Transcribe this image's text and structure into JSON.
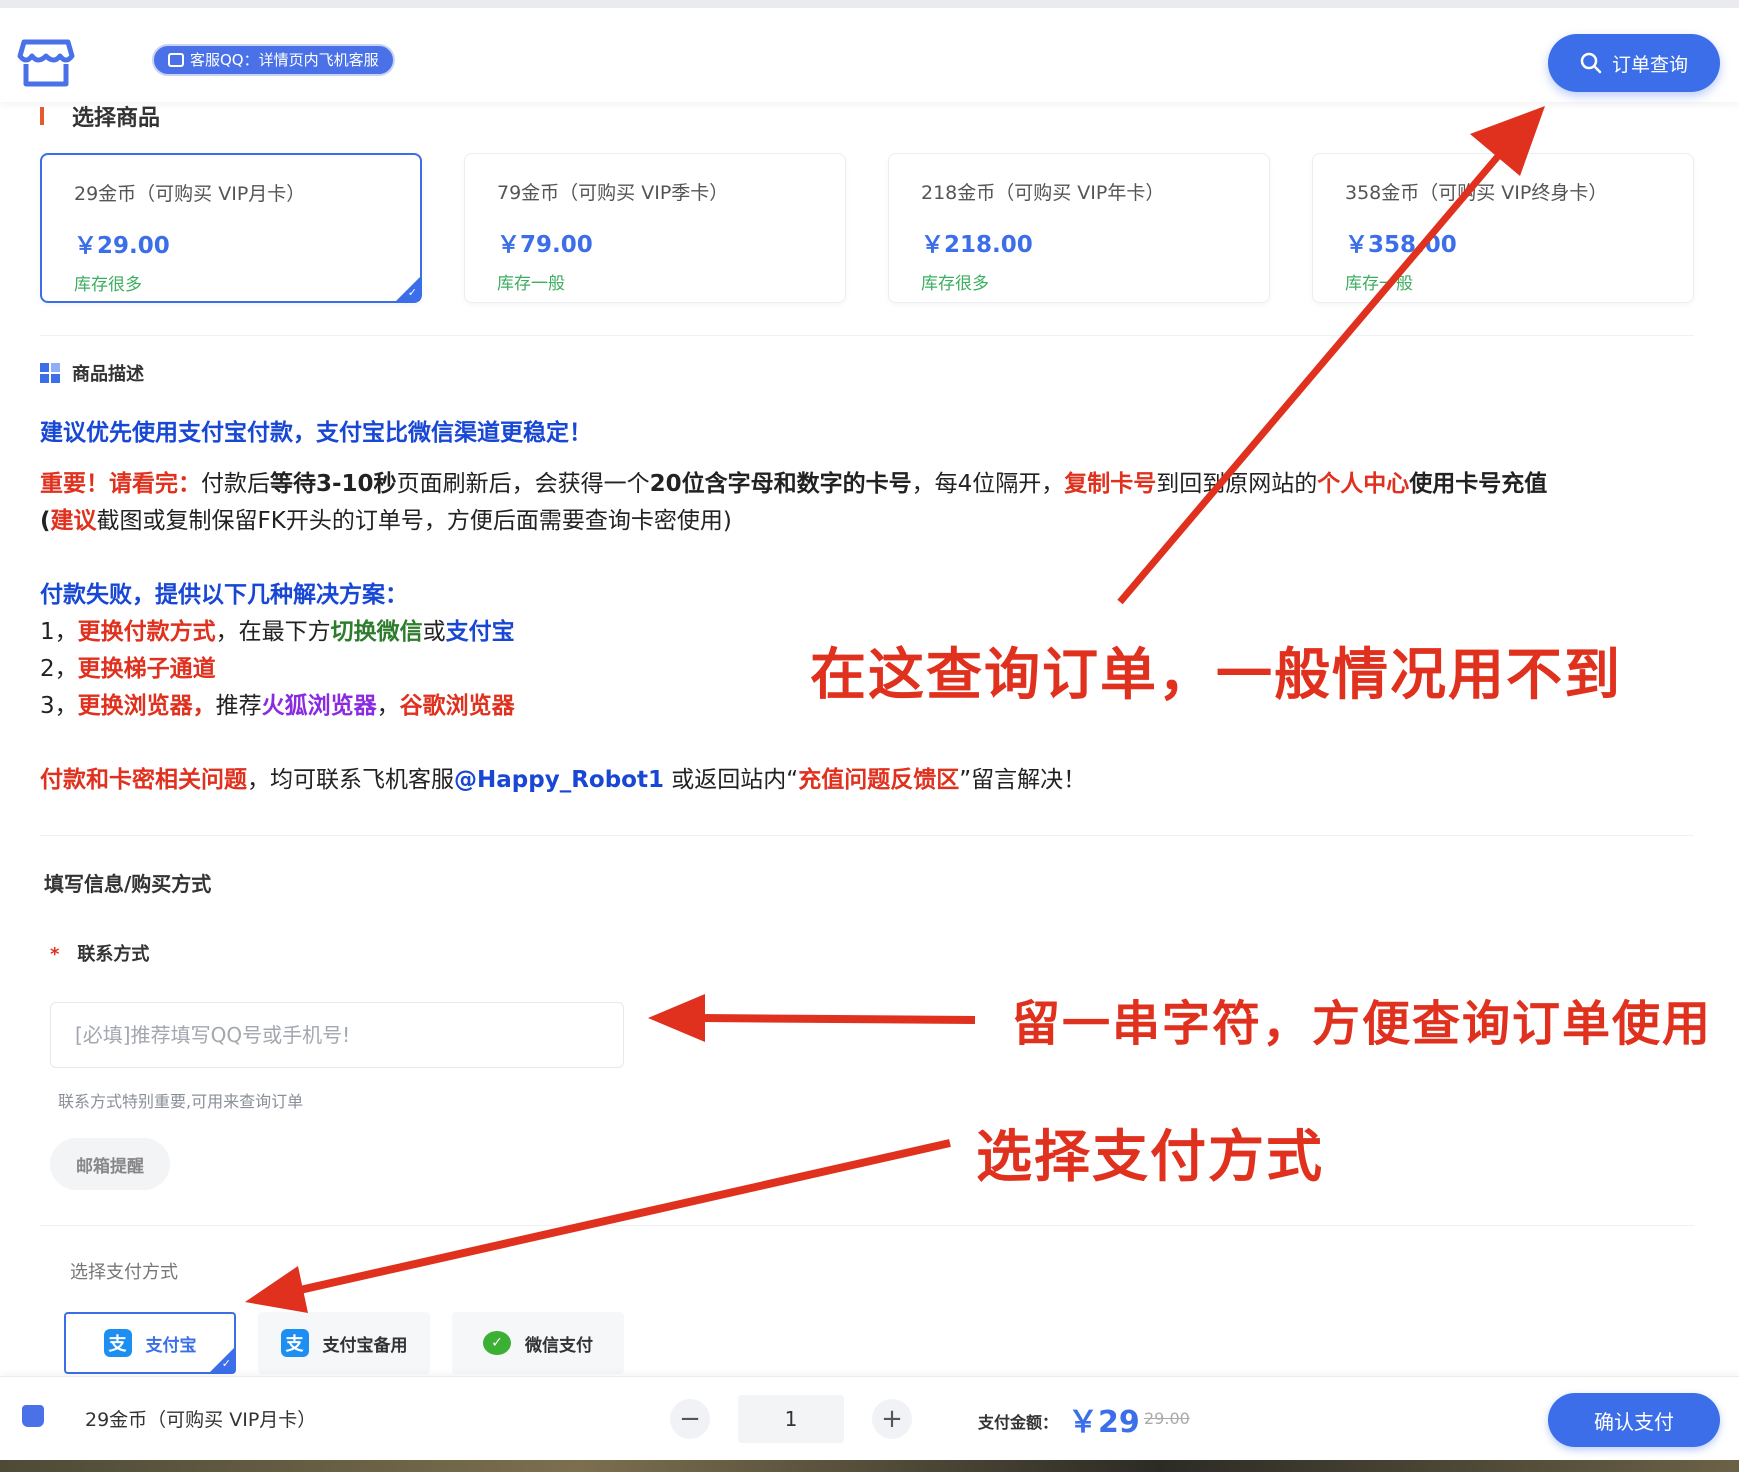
{
  "header": {
    "qq_badge": "客服QQ：详情页内飞机客服",
    "order_query_label": "订单查询"
  },
  "products_section": {
    "title": "选择商品",
    "items": [
      {
        "name": "29金币（可购买 VIP月卡）",
        "price": "￥29.00",
        "stock": "库存很多",
        "selected": true
      },
      {
        "name": "79金币（可购买 VIP季卡）",
        "price": "￥79.00",
        "stock": "库存一般",
        "selected": false
      },
      {
        "name": "218金币（可购买 VIP年卡）",
        "price": "￥218.00",
        "stock": "库存很多",
        "selected": false
      },
      {
        "name": "358金币（可购买 VIP终身卡）",
        "price": "￥358.00",
        "stock": "库存一般",
        "selected": false
      }
    ]
  },
  "description": {
    "title": "商品描述",
    "line1": "建议优先使用支付宝付款，支付宝比微信渠道更稳定！",
    "line2": {
      "a": "重要！请看完：",
      "b": "付款后",
      "c": "等待3-10秒",
      "d": "页面刷新后，会获得一个",
      "e": "20位含字母和数字的卡号",
      "f": "，每4位隔开，",
      "g": "复制卡号",
      "h": "到回到原网站的",
      "i": "个人中心",
      "j": "使用卡号充值"
    },
    "line3": {
      "a": "(",
      "b": "建议",
      "c": "截图或复制保留FK开头的订单号，方便后面需要查询卡密使用)"
    },
    "fail_title": "付款失败，提供以下几种解决方案：",
    "fail1": {
      "num": "1，",
      "a": "更换付款方式",
      "b": "，在最下方",
      "c": "切换微信",
      "d": "或",
      "e": "支付宝"
    },
    "fail2": {
      "num": "2，",
      "a": "更换梯子通道"
    },
    "fail3": {
      "num": "3，",
      "a": "更换浏览器，",
      "b": "推荐",
      "c": "火狐浏览器",
      "d": "，",
      "e": "谷歌浏览器"
    },
    "contact": {
      "a": "付款和卡密相关问题",
      "b": "，均可联系飞机客服",
      "c": "@Happy_Robot1",
      "d": " 或返回站内“",
      "e": "充值问题反馈区",
      "f": "”留言解决！"
    }
  },
  "form": {
    "title": "填写信息/购买方式",
    "contact_label": "联系方式",
    "required_mark": "*",
    "contact_placeholder": "[必填]推荐填写QQ号或手机号!",
    "contact_value": "",
    "contact_hint": "联系方式特别重要,可用来查询订单",
    "mail_reminder": "邮箱提醒",
    "pay_title": "选择支付方式",
    "pay_methods": [
      {
        "label": "支付宝",
        "icon": "alipay-icon",
        "selected": true
      },
      {
        "label": "支付宝备用",
        "icon": "alipay-icon",
        "selected": false
      },
      {
        "label": "微信支付",
        "icon": "wechat-icon",
        "selected": false
      }
    ]
  },
  "bottom": {
    "product_name": "29金币（可购买 VIP月卡）",
    "quantity": "1",
    "minus": "−",
    "plus": "+",
    "pay_label": "支付金额：",
    "pay_amount": "￥29",
    "original_amount": "29.00",
    "confirm_label": "确认支付"
  },
  "annotations": {
    "query_note": "在这查询订单，一般情况用不到",
    "contact_note": "留一串字符，方便查询订单使用",
    "pay_note": "选择支付方式",
    "color": "#e0301e"
  },
  "colors": {
    "primary": "#3b6ee8",
    "stock_green": "#3cae5f",
    "danger": "#e0301e"
  }
}
